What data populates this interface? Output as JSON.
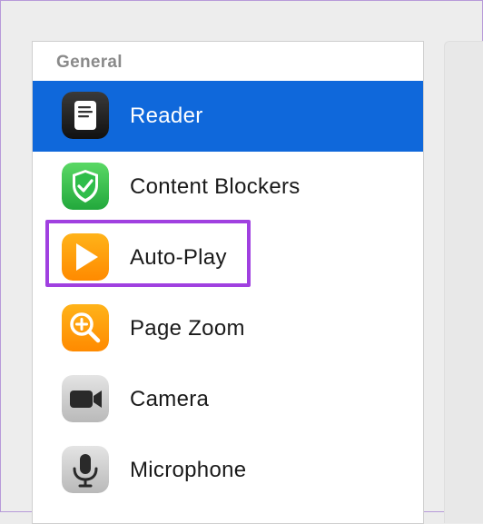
{
  "sidebar": {
    "section_header": "General",
    "items": [
      {
        "label": "Reader",
        "icon": "reader-icon",
        "selected": true
      },
      {
        "label": "Content Blockers",
        "icon": "content-blockers-shield-icon",
        "selected": false
      },
      {
        "label": "Auto-Play",
        "icon": "auto-play-icon",
        "selected": false
      },
      {
        "label": "Page Zoom",
        "icon": "page-zoom-icon",
        "selected": false
      },
      {
        "label": "Camera",
        "icon": "camera-icon",
        "selected": false
      },
      {
        "label": "Microphone",
        "icon": "microphone-icon",
        "selected": false
      }
    ]
  },
  "colors": {
    "selection": "#0f68db",
    "highlight": "#a040e0"
  }
}
